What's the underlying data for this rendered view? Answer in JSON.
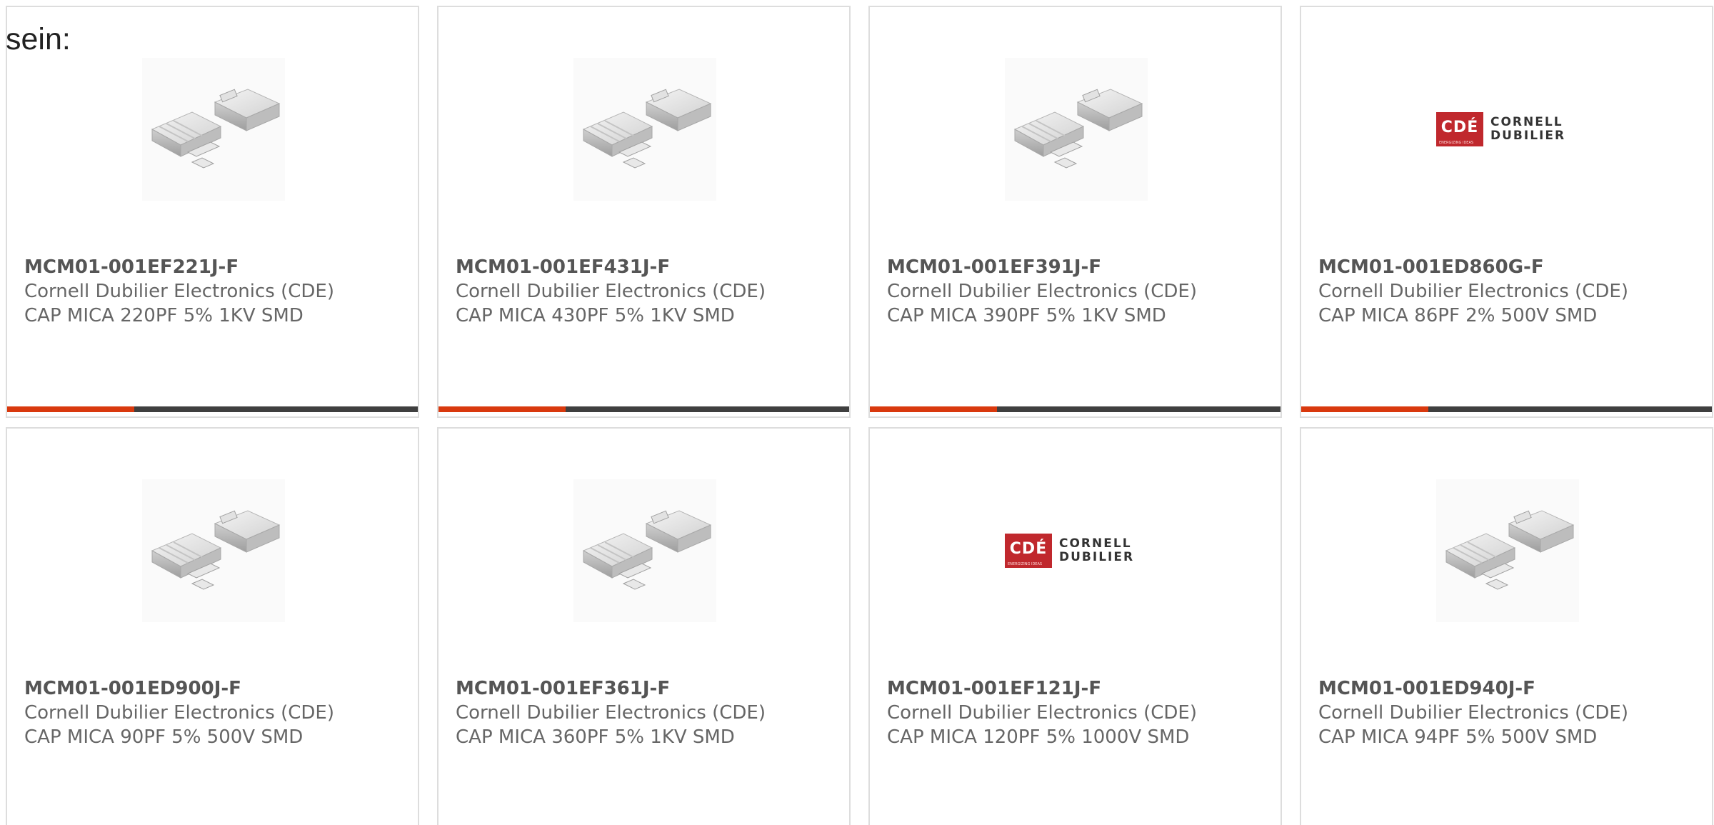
{
  "intro_text": "sein:",
  "colors": {
    "accent": "#d9390e",
    "track": "#3f3f3f",
    "card_border": "#dddddd",
    "text": "#666666",
    "logo_red": "#c0282d"
  },
  "products": [
    {
      "part_number": "MCM01-001EF221J-F",
      "manufacturer": "Cornell Dubilier Electronics (CDE)",
      "description": "CAP MICA 220PF 5% 1KV SMD",
      "image": "capacitor-image",
      "progress": 0.31
    },
    {
      "part_number": "MCM01-001EF431J-F",
      "manufacturer": "Cornell Dubilier Electronics (CDE)",
      "description": "CAP MICA 430PF 5% 1KV SMD",
      "image": "capacitor-image",
      "progress": 0.31
    },
    {
      "part_number": "MCM01-001EF391J-F",
      "manufacturer": "Cornell Dubilier Electronics (CDE)",
      "description": "CAP MICA 390PF 5% 1KV SMD",
      "image": "capacitor-image",
      "progress": 0.31
    },
    {
      "part_number": "MCM01-001ED860G-F",
      "manufacturer": "Cornell Dubilier Electronics (CDE)",
      "description": "CAP MICA 86PF 2% 500V SMD",
      "image": "cde-logo",
      "progress": 0.31,
      "logo": {
        "mark": "CDÉ",
        "line1": "CORNELL",
        "line2": "DUBILIER",
        "tagline": "ENERGIZING IDEAS"
      }
    },
    {
      "part_number": "MCM01-001ED900J-F",
      "manufacturer": "Cornell Dubilier Electronics (CDE)",
      "description": "CAP MICA 90PF 5% 500V SMD",
      "image": "capacitor-image"
    },
    {
      "part_number": "MCM01-001EF361J-F",
      "manufacturer": "Cornell Dubilier Electronics (CDE)",
      "description": "CAP MICA 360PF 5% 1KV SMD",
      "image": "capacitor-image"
    },
    {
      "part_number": "MCM01-001EF121J-F",
      "manufacturer": "Cornell Dubilier Electronics (CDE)",
      "description": "CAP MICA 120PF 5% 1000V SMD",
      "image": "cde-logo",
      "logo": {
        "mark": "CDÉ",
        "line1": "CORNELL",
        "line2": "DUBILIER",
        "tagline": "ENERGIZING IDEAS"
      }
    },
    {
      "part_number": "MCM01-001ED940J-F",
      "manufacturer": "Cornell Dubilier Electronics (CDE)",
      "description": "CAP MICA 94PF 5% 500V SMD",
      "image": "capacitor-image"
    }
  ]
}
